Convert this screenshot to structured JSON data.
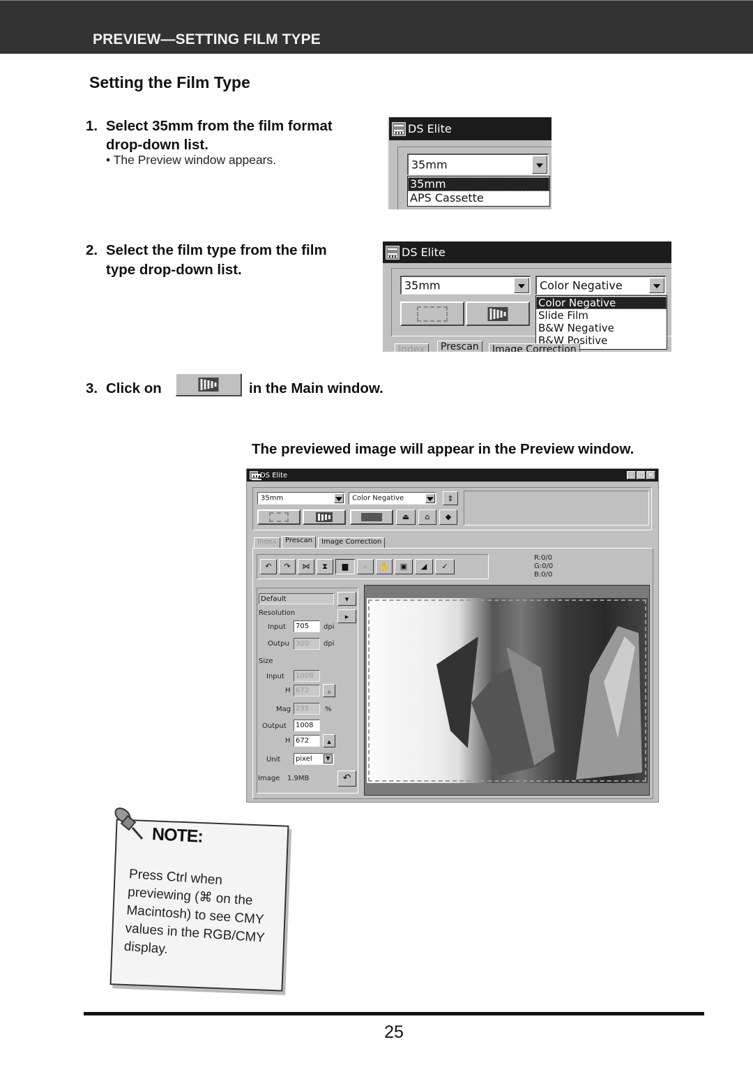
{
  "header": {
    "title": "PREVIEW—SETTING FILM TYPE"
  },
  "section_title": "Setting the Film Type",
  "steps": [
    {
      "num": "1.",
      "lines": [
        "Select 35mm from the film format",
        "drop-down list."
      ],
      "bullet": "• The Preview window appears."
    },
    {
      "num": "2.",
      "lines": [
        "Select the film type from the film",
        "type drop-down list."
      ]
    },
    {
      "num": "3.",
      "before": "Click on",
      "after": "in the Main window."
    }
  ],
  "preview_caption": "The previewed image will appear in the Preview window.",
  "screenshot1": {
    "title": "DS Elite",
    "film_format_value": "35mm",
    "options": [
      "35mm",
      "APS Cassette"
    ],
    "selected_index": 0
  },
  "screenshot2": {
    "title": "DS Elite",
    "film_format_value": "35mm",
    "film_type_value": "Color Negative",
    "options": [
      "Color Negative",
      "Slide Film",
      "B&W Negative",
      "B&W Positive"
    ],
    "selected_index": 0,
    "tabs": [
      "Index",
      "Prescan",
      "Image Correction"
    ]
  },
  "main_window": {
    "title": "DS Elite",
    "film_format_value": "35mm",
    "film_type_value": "Color Negative",
    "tabs": [
      "Index",
      "Prescan",
      "Image Correction"
    ],
    "active_tab": "Prescan",
    "rgb": {
      "r": "R:0/0",
      "g": "G:0/0",
      "b": "B:0/0"
    },
    "settings": {
      "preset": "Default",
      "resolution_label": "Resolution",
      "input_label": "Input",
      "input_dpi": "705",
      "output_label": "Outpu",
      "output_dpi": "300",
      "dpi_unit": "dpi",
      "size_label": "Size",
      "size_input_label": "Input",
      "size_input_w": "1008",
      "h_label": "H",
      "size_input_h": "672",
      "mag_label": "Mag",
      "mag_value": "235",
      "mag_unit": "%",
      "output_size_label": "Output",
      "output_w": "1008",
      "output_h": "672",
      "unit_label": "Unit",
      "unit_value": "pixel",
      "image_label": "Image",
      "image_size": "1.9MB"
    }
  },
  "note": {
    "title": "NOTE:",
    "text": "Press Ctrl when previewing (⌘ on the Macintosh) to see CMY values in the RGB/CMY display."
  },
  "page_number": "25"
}
